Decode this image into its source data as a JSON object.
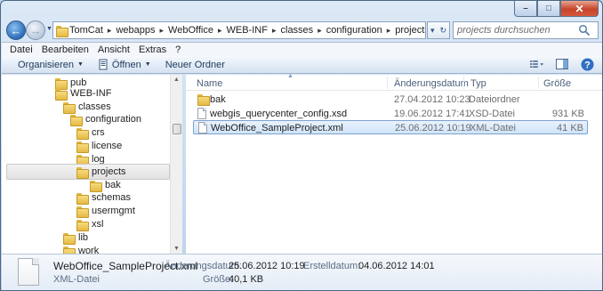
{
  "window": {
    "controls": {
      "minimize": "–",
      "maximize": "□",
      "close": "✕"
    }
  },
  "address": {
    "overflow": "«",
    "crumbs": [
      "TomCat",
      "webapps",
      "WebOffice",
      "WEB-INF",
      "classes",
      "configuration",
      "projects"
    ]
  },
  "search": {
    "placeholder": "projects durchsuchen"
  },
  "menu": [
    "Datei",
    "Bearbeiten",
    "Ansicht",
    "Extras",
    "?"
  ],
  "toolbar": {
    "organize": "Organisieren",
    "open": "Öffnen",
    "new_folder": "Neuer Ordner"
  },
  "tree": [
    {
      "label": "pub"
    },
    {
      "label": "WEB-INF"
    },
    {
      "label": "classes"
    },
    {
      "label": "configuration"
    },
    {
      "label": "crs"
    },
    {
      "label": "license"
    },
    {
      "label": "log"
    },
    {
      "label": "projects"
    },
    {
      "label": "bak"
    },
    {
      "label": "schemas"
    },
    {
      "label": "usermgmt"
    },
    {
      "label": "xsl"
    },
    {
      "label": "lib"
    },
    {
      "label": "work"
    }
  ],
  "columns": {
    "name": "Name",
    "date": "Änderungsdatum",
    "type": "Typ",
    "size": "Größe"
  },
  "files": [
    {
      "name": "bak",
      "date": "27.04.2012 10:23",
      "type": "Dateiordner",
      "size": ""
    },
    {
      "name": "webgis_querycenter_config.xsd",
      "date": "19.06.2012 17:41",
      "type": "XSD-Datei",
      "size": "931 KB"
    },
    {
      "name": "WebOffice_SampleProject.xml",
      "date": "25.06.2012 10:19",
      "type": "XML-Datei",
      "size": "41 KB"
    }
  ],
  "details": {
    "name": "WebOffice_SampleProject.xml",
    "type": "XML-Datei",
    "modified_label": "Änderungsdatum:",
    "modified": "25.06.2012 10:19",
    "created_label": "Erstelldatum:",
    "created": "04.06.2012 14:01",
    "size_label": "Größe:",
    "size": "40,1 KB"
  },
  "colors": {
    "selection": "#cfe4fa",
    "selection_border": "#7da2ce",
    "folder": "#e5b944"
  }
}
